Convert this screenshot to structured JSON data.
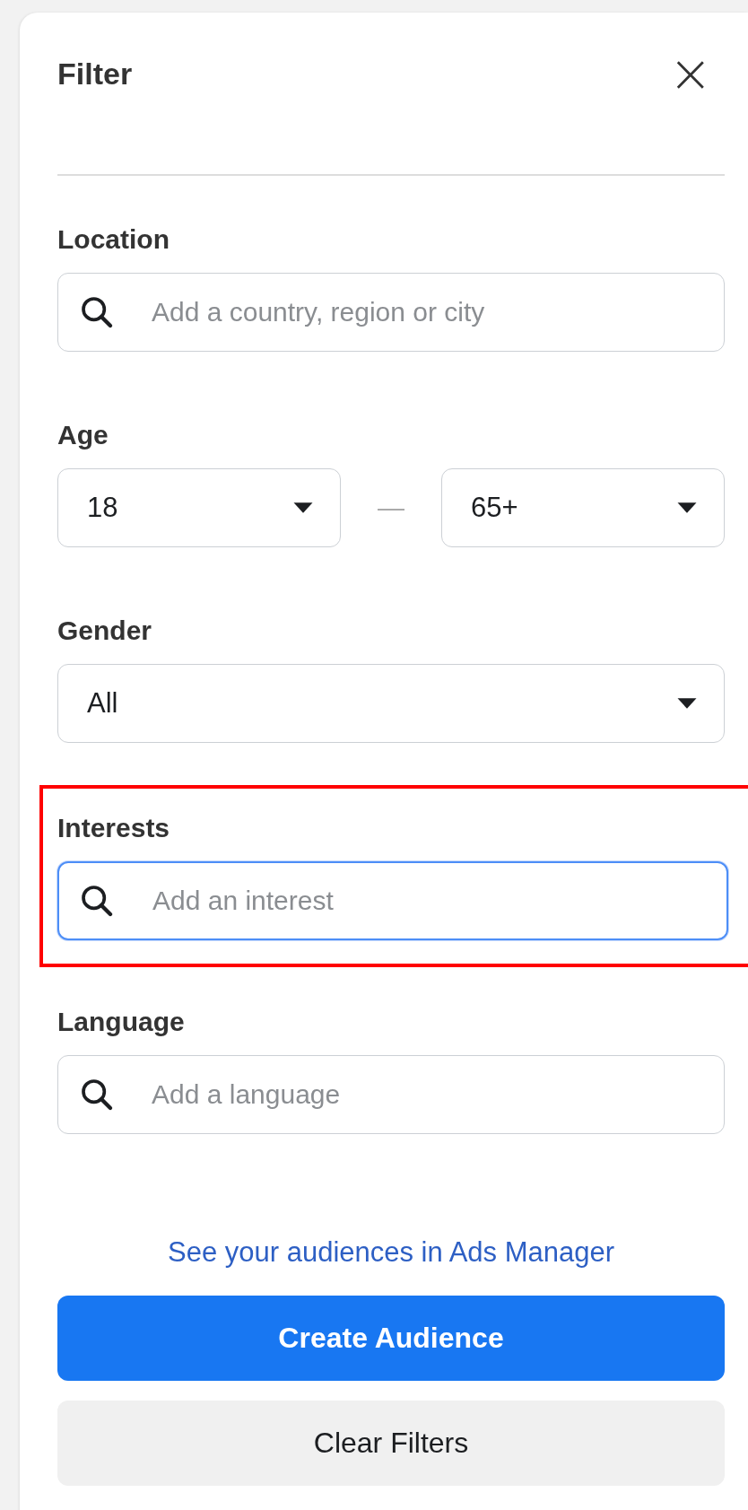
{
  "panel": {
    "title": "Filter",
    "close": "×"
  },
  "sections": [
    {
      "label": "Location",
      "kind": "search",
      "placeholder": "Add a country, region or city",
      "focused": false,
      "highlighted": false
    },
    {
      "label": "Age",
      "kind": "range",
      "from": "18",
      "separator": "—",
      "to": "65+",
      "highlighted": false
    },
    {
      "label": "Gender",
      "kind": "select",
      "value": "All",
      "highlighted": false
    },
    {
      "label": "Interests",
      "kind": "search",
      "placeholder": "Add an interest",
      "focused": true,
      "highlighted": true
    },
    {
      "label": "Language",
      "kind": "search",
      "placeholder": "Add a language",
      "focused": false,
      "highlighted": false
    }
  ],
  "link": "See your audiences in Ads Manager",
  "buttons": [
    {
      "label": "Create Audience",
      "kind": "primary"
    },
    {
      "label": "Clear Filters",
      "kind": "secondary"
    }
  ]
}
